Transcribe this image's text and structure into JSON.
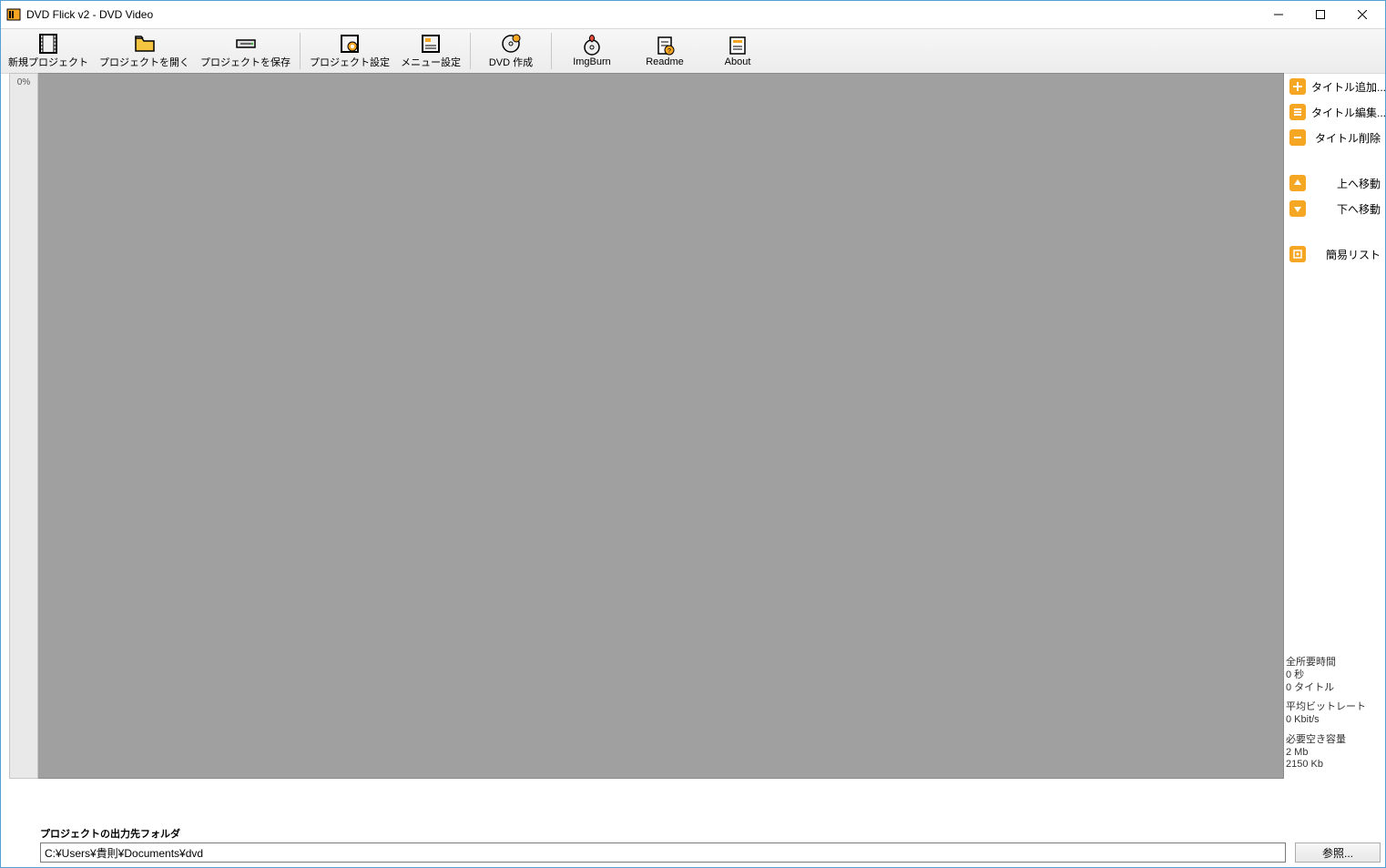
{
  "window": {
    "title": "DVD Flick v2 - DVD Video"
  },
  "toolbar": {
    "new": "新規プロジェクト",
    "open": "プロジェクトを開く",
    "save": "プロジェクトを保存",
    "psettings": "プロジェクト設定",
    "msettings": "メニュー設定",
    "create": "DVD 作成",
    "imgburn": "ImgBurn",
    "readme": "Readme",
    "about": "About"
  },
  "progress": {
    "percent": "0%"
  },
  "sidebar": {
    "add": "タイトル追加...",
    "edit": "タイトル編集...",
    "del": "タイトル削除",
    "up": "上へ移動",
    "down": "下へ移動",
    "simple": "簡易リスト"
  },
  "stats": {
    "durLabel": "全所要時間",
    "durValue": "0 秒",
    "titleCount": "0 タイトル",
    "brLabel": "平均ビットレート",
    "brValue": "0 Kbit/s",
    "spaceLabel": "必要空き容量",
    "spaceMb": "2 Mb",
    "spaceKb": "2150 Kb"
  },
  "output": {
    "label": "プロジェクトの出力先フォルダ",
    "path": "C:¥Users¥貴則¥Documents¥dvd",
    "browse": "参照..."
  }
}
